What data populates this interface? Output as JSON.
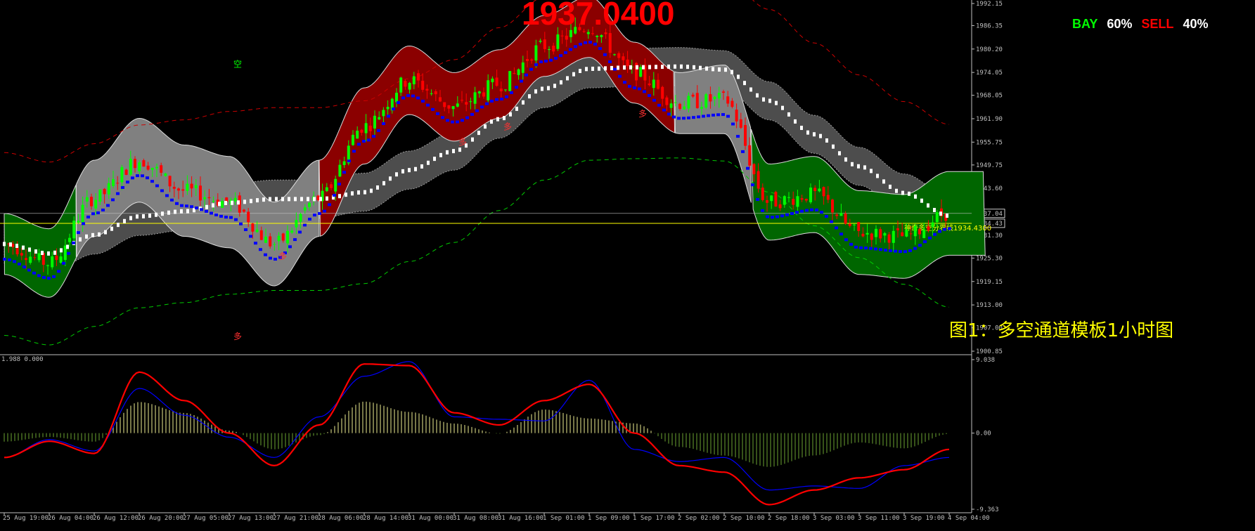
{
  "header": {
    "price_display": "1937.0400",
    "bay_label": "BAY",
    "bay_value": "60%",
    "sell_label": "SELL",
    "sell_value": "40%"
  },
  "caption": "图1：多空通道模板1小时图",
  "boundary_label": "神奇多空分界线1934.4300",
  "oscillator_label": "1.988 0.000",
  "colors": {
    "bull": "#00ff00",
    "bear": "#ff0000",
    "white_channel": "#ffffff",
    "blue_line": "#0000ff",
    "magenta": "#ff00ff",
    "ma_yellow": "#ffff00",
    "osc_red": "#ff0000",
    "osc_blue": "#0000ff"
  },
  "chart_data": [
    {
      "type": "candlestick",
      "title": "",
      "xlabel": "",
      "ylabel": "",
      "ylim": [
        1900.85,
        1992.15
      ],
      "y_ticks": [
        "1992.15",
        "1986.35",
        "1980.20",
        "1974.05",
        "1968.05",
        "1961.90",
        "1955.75",
        "1949.75",
        "1943.60",
        "1937.04",
        "1934.43",
        "1931.30",
        "1925.30",
        "1919.15",
        "1913.00",
        "1907.00",
        "1900.85"
      ],
      "x_ticks": [
        "25 Aug 19:00",
        "26 Aug 04:00",
        "26 Aug 12:00",
        "26 Aug 20:00",
        "27 Aug 05:00",
        "27 Aug 13:00",
        "27 Aug 21:00",
        "28 Aug 06:00",
        "28 Aug 14:00",
        "31 Aug 00:00",
        "31 Aug 08:00",
        "31 Aug 16:00",
        "1 Sep 01:00",
        "1 Sep 09:00",
        "1 Sep 17:00",
        "2 Sep 02:00",
        "2 Sep 10:00",
        "2 Sep 18:00",
        "3 Sep 03:00",
        "3 Sep 11:00",
        "3 Sep 19:00",
        "4 Sep 04:00"
      ],
      "current_price": 1937.04,
      "boundary_level": 1934.43,
      "markers": [
        {
          "text": "空",
          "x": "27 Aug 13:00",
          "y": 1975.5
        },
        {
          "text": "多",
          "x": "27 Aug 13:00",
          "y": 1904.0
        },
        {
          "text": "多",
          "x": "27 Aug 21:00",
          "y": 1925.0
        },
        {
          "text": "多",
          "x": "31 Aug 08:00",
          "y": 1955.0
        },
        {
          "text": "多",
          "x": "31 Aug 16:00",
          "y": 1959.0
        },
        {
          "text": "多",
          "x": "1 Sep 17:00",
          "y": 1962.5
        }
      ],
      "series": [
        {
          "x": [
            "25 Aug 19:00",
            "26 Aug 04:00",
            "26 Aug 12:00",
            "26 Aug 20:00",
            "27 Aug 05:00",
            "27 Aug 13:00",
            "27 Aug 21:00",
            "28 Aug 06:00",
            "28 Aug 14:00",
            "31 Aug 00:00",
            "31 Aug 08:00",
            "31 Aug 16:00",
            "1 Sep 01:00",
            "1 Sep 09:00",
            "1 Sep 17:00",
            "2 Sep 02:00",
            "2 Sep 10:00",
            "2 Sep 18:00",
            "3 Sep 03:00",
            "3 Sep 11:00",
            "3 Sep 19:00",
            "4 Sep 04:00"
          ],
          "close": [
            1929.0,
            1924.0,
            1941.0,
            1951.0,
            1943.0,
            1940.0,
            1929.0,
            1941.0,
            1960.0,
            1972.0,
            1965.0,
            1971.0,
            1981.0,
            1986.0,
            1974.0,
            1966.0,
            1967.0,
            1940.0,
            1942.0,
            1932.0,
            1931.0,
            1937.04
          ]
        }
      ]
    },
    {
      "type": "line",
      "title": "",
      "ylim": [
        -9.363,
        9.038
      ],
      "y_ticks": [
        "9.038",
        "0.00",
        "-9.363"
      ],
      "x": [
        "25 Aug 19:00",
        "26 Aug 04:00",
        "26 Aug 12:00",
        "26 Aug 20:00",
        "27 Aug 05:00",
        "27 Aug 13:00",
        "27 Aug 21:00",
        "28 Aug 06:00",
        "28 Aug 14:00",
        "31 Aug 00:00",
        "31 Aug 08:00",
        "31 Aug 16:00",
        "1 Sep 01:00",
        "1 Sep 09:00",
        "1 Sep 17:00",
        "2 Sep 02:00",
        "2 Sep 10:00",
        "2 Sep 18:00",
        "3 Sep 03:00",
        "3 Sep 11:00",
        "3 Sep 19:00",
        "4 Sep 04:00"
      ],
      "series": [
        {
          "values": [
            -3.0,
            -0.8,
            -2.2,
            5.5,
            2.2,
            -0.5,
            -3.0,
            2.0,
            7.0,
            8.8,
            2.0,
            1.7,
            1.5,
            6.5,
            -2.0,
            -3.5,
            -3.0,
            -7.0,
            -6.5,
            -6.8,
            -4.0,
            -3.0
          ]
        },
        {
          "values": [
            -3.0,
            -1.0,
            -2.5,
            7.5,
            4.0,
            0.0,
            -4.0,
            1.0,
            8.5,
            8.3,
            2.5,
            1.0,
            4.0,
            6.0,
            0.0,
            -4.0,
            -4.8,
            -8.8,
            -7.0,
            -5.5,
            -4.5,
            -2.0
          ]
        }
      ]
    }
  ]
}
